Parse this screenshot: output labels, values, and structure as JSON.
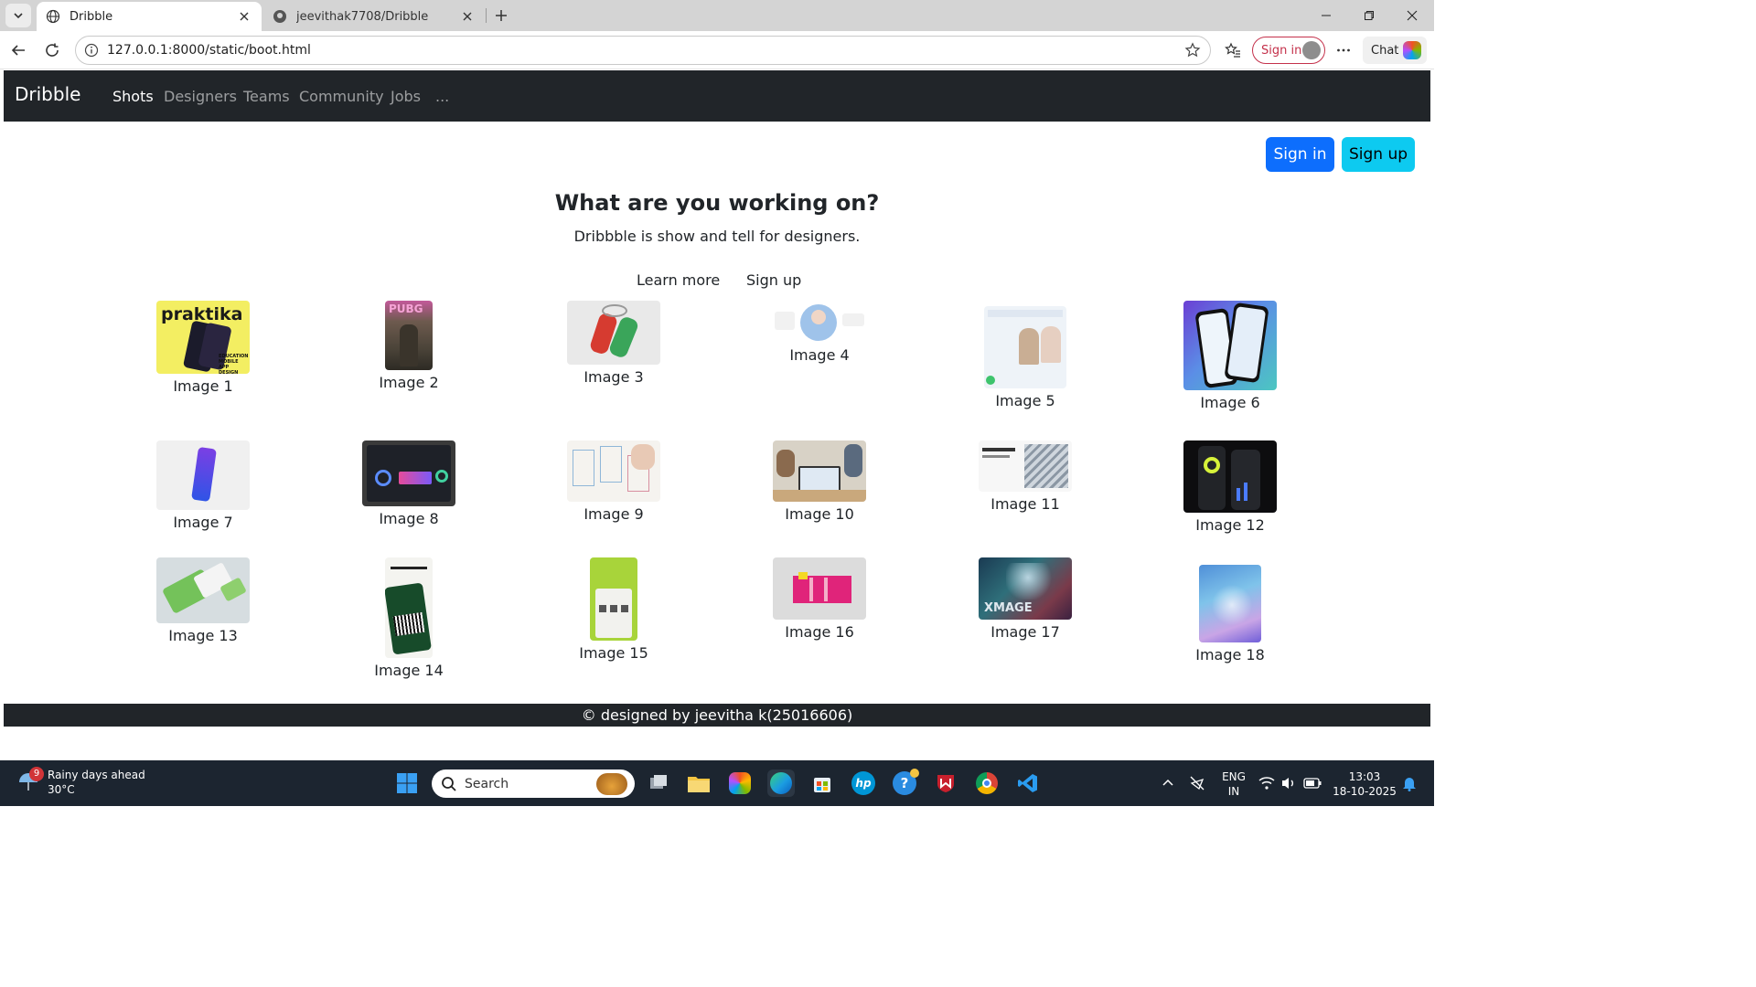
{
  "browser": {
    "tabs": [
      {
        "title": "Dribble",
        "active": true
      },
      {
        "title": "jeevithak7708/Dribble",
        "active": false
      }
    ],
    "url": "127.0.0.1:8000/static/boot.html",
    "profile_button": "Sign in",
    "chat_button": "Chat"
  },
  "navbar": {
    "brand": "Dribble",
    "links": [
      "Shots",
      "Designers",
      "Teams",
      "Community",
      "Jobs",
      "..."
    ],
    "active_link": "Shots"
  },
  "auth": {
    "sign_in": "Sign in",
    "sign_up": "Sign up"
  },
  "hero": {
    "title": "What are you working on?",
    "subtitle": "Dribbble is show and tell for designers.",
    "learn_more": "Learn more",
    "sign_up": "Sign up"
  },
  "shots": [
    {
      "caption": "Image 1"
    },
    {
      "caption": "Image 2"
    },
    {
      "caption": "Image 3"
    },
    {
      "caption": "Image 4"
    },
    {
      "caption": "Image 5"
    },
    {
      "caption": "Image 6"
    },
    {
      "caption": "Image 7"
    },
    {
      "caption": "Image 8"
    },
    {
      "caption": "Image 9"
    },
    {
      "caption": "Image 10"
    },
    {
      "caption": "Image 11"
    },
    {
      "caption": "Image 12"
    },
    {
      "caption": "Image 13"
    },
    {
      "caption": "Image 14"
    },
    {
      "caption": "Image 15"
    },
    {
      "caption": "Image 16"
    },
    {
      "caption": "Image 17"
    },
    {
      "caption": "Image 18"
    }
  ],
  "thumb_text": {
    "t1": "praktika",
    "t1b": "EDUCATION MOBILE APP DESIGN",
    "t2": "PUBG",
    "t17": "XMAGE"
  },
  "footer": "© designed by jeevitha k(25016606)",
  "taskbar": {
    "weather_badge": "9",
    "weather_title": "Rainy days ahead",
    "weather_temp": "30°C",
    "search_placeholder": "Search",
    "lang_1": "ENG",
    "lang_2": "IN",
    "time": "13:03",
    "date": "18-10-2025"
  },
  "colors": {
    "navbar": "#212529",
    "primary": "#0d6efd",
    "info": "#0dcaf0",
    "taskbar": "#1c2530"
  }
}
